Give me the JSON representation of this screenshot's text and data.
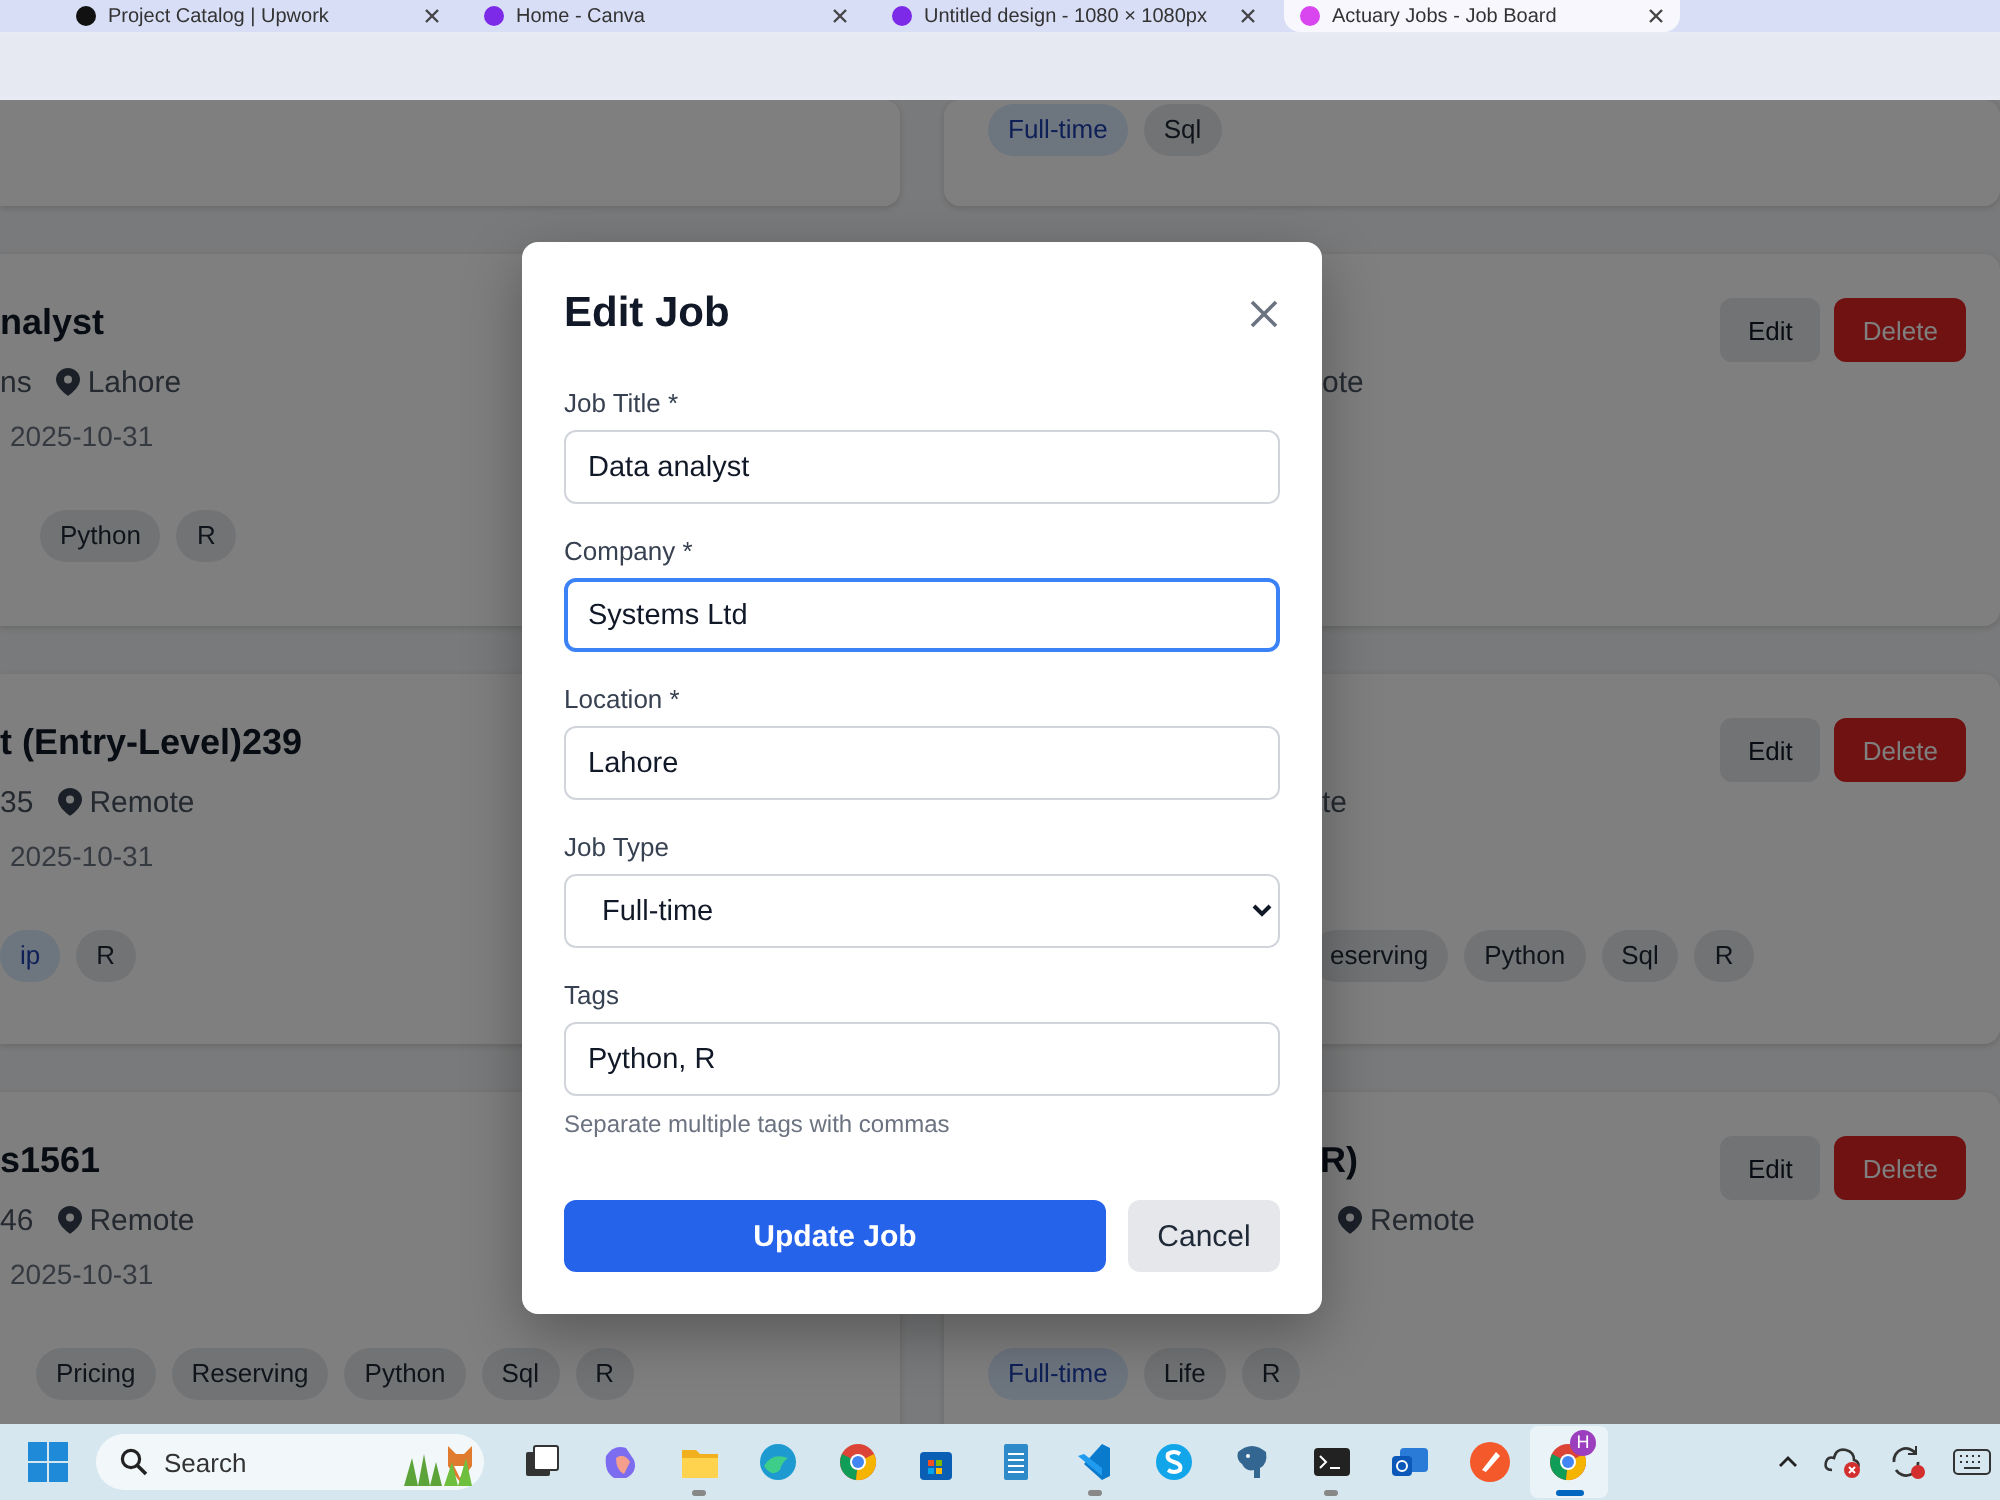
{
  "browser": {
    "tabs": [
      {
        "title": "Project Catalog | Upwork",
        "selected": false,
        "color": "#111111"
      },
      {
        "title": "Home - Canva",
        "selected": false,
        "color": "#7d2ae8"
      },
      {
        "title": "Untitled design - 1080 × 1080px",
        "selected": false,
        "color": "#7d2ae8"
      },
      {
        "title": "Actuary Jobs - Job Board",
        "selected": true,
        "color": "#d946ef"
      }
    ]
  },
  "job_rows": [
    {
      "right": {
        "tags": [
          {
            "label": "Full-time",
            "kind": "type"
          },
          {
            "label": "Sql",
            "kind": "skill"
          }
        ]
      }
    },
    {
      "left": {
        "title": "nalyst",
        "company": "ns",
        "location": "Lahore",
        "date": "2025-10-31",
        "tags": [
          {
            "label": "Python",
            "kind": "skill"
          },
          {
            "label": "R",
            "kind": "skill"
          }
        ]
      },
      "right": {
        "location": "ote",
        "actions": [
          "Edit",
          "Delete"
        ]
      }
    },
    {
      "left": {
        "title": "t (Entry-Level)239",
        "company": "35",
        "location": "Remote",
        "date": "2025-10-31",
        "tags": [
          {
            "label": "ip",
            "kind": "type"
          },
          {
            "label": "R",
            "kind": "skill"
          }
        ]
      },
      "right": {
        "location": "te",
        "actions": [
          "Edit",
          "Delete"
        ],
        "tags": [
          {
            "label": "eserving",
            "kind": "skill"
          },
          {
            "label": "Python",
            "kind": "skill"
          },
          {
            "label": "Sql",
            "kind": "skill"
          },
          {
            "label": "R",
            "kind": "skill"
          }
        ]
      }
    },
    {
      "left": {
        "title": "s1561",
        "company": "46",
        "location": "Remote",
        "date": "2025-10-31",
        "tags": [
          {
            "label": "Pricing",
            "kind": "skill"
          },
          {
            "label": "Reserving",
            "kind": "skill"
          },
          {
            "label": "Python",
            "kind": "skill"
          },
          {
            "label": "Sql",
            "kind": "skill"
          },
          {
            "label": "R",
            "kind": "skill"
          }
        ]
      },
      "right": {
        "title": "R)",
        "location": "Remote",
        "actions": [
          "Edit",
          "Delete"
        ],
        "tags": [
          {
            "label": "Full-time",
            "kind": "type"
          },
          {
            "label": "Life",
            "kind": "skill"
          },
          {
            "label": "R",
            "kind": "skill"
          }
        ]
      }
    }
  ],
  "modal": {
    "title": "Edit Job",
    "fields": [
      {
        "label": "Job Title *",
        "kind": "text",
        "value": "Data analyst",
        "focused": false
      },
      {
        "label": "Company *",
        "kind": "text",
        "value": "Systems Ltd",
        "focused": true
      },
      {
        "label": "Location *",
        "kind": "text",
        "value": "Lahore",
        "focused": false
      },
      {
        "label": "Job Type",
        "kind": "select",
        "value": "Full-time",
        "focused": false
      },
      {
        "label": "Tags",
        "kind": "text",
        "value": "Python, R",
        "focused": false,
        "hint": "Separate multiple tags with commas"
      }
    ],
    "buttons": [
      {
        "label": "Update Job",
        "kind": "primary"
      },
      {
        "label": "Cancel",
        "kind": "secondary"
      }
    ]
  },
  "taskbar": {
    "search": {
      "placeholder": "Search"
    },
    "apps": [
      {
        "kind": "taskview",
        "running": false,
        "active": false
      },
      {
        "kind": "copilot",
        "running": false,
        "active": false
      },
      {
        "kind": "folder",
        "running": true,
        "active": false
      },
      {
        "kind": "edge",
        "running": false,
        "active": false
      },
      {
        "kind": "chrome",
        "running": false,
        "active": false
      },
      {
        "kind": "store",
        "running": false,
        "active": false
      },
      {
        "kind": "notepad",
        "running": false,
        "active": false
      },
      {
        "kind": "code",
        "running": true,
        "active": false
      },
      {
        "kind": "chat",
        "running": false,
        "active": false
      },
      {
        "kind": "elephant",
        "running": false,
        "active": false
      },
      {
        "kind": "terminal",
        "running": true,
        "active": false
      },
      {
        "kind": "mail",
        "running": false,
        "active": false
      },
      {
        "kind": "pen",
        "running": false,
        "active": false
      },
      {
        "kind": "chrome",
        "running": true,
        "active": true,
        "badge": "H"
      }
    ]
  }
}
